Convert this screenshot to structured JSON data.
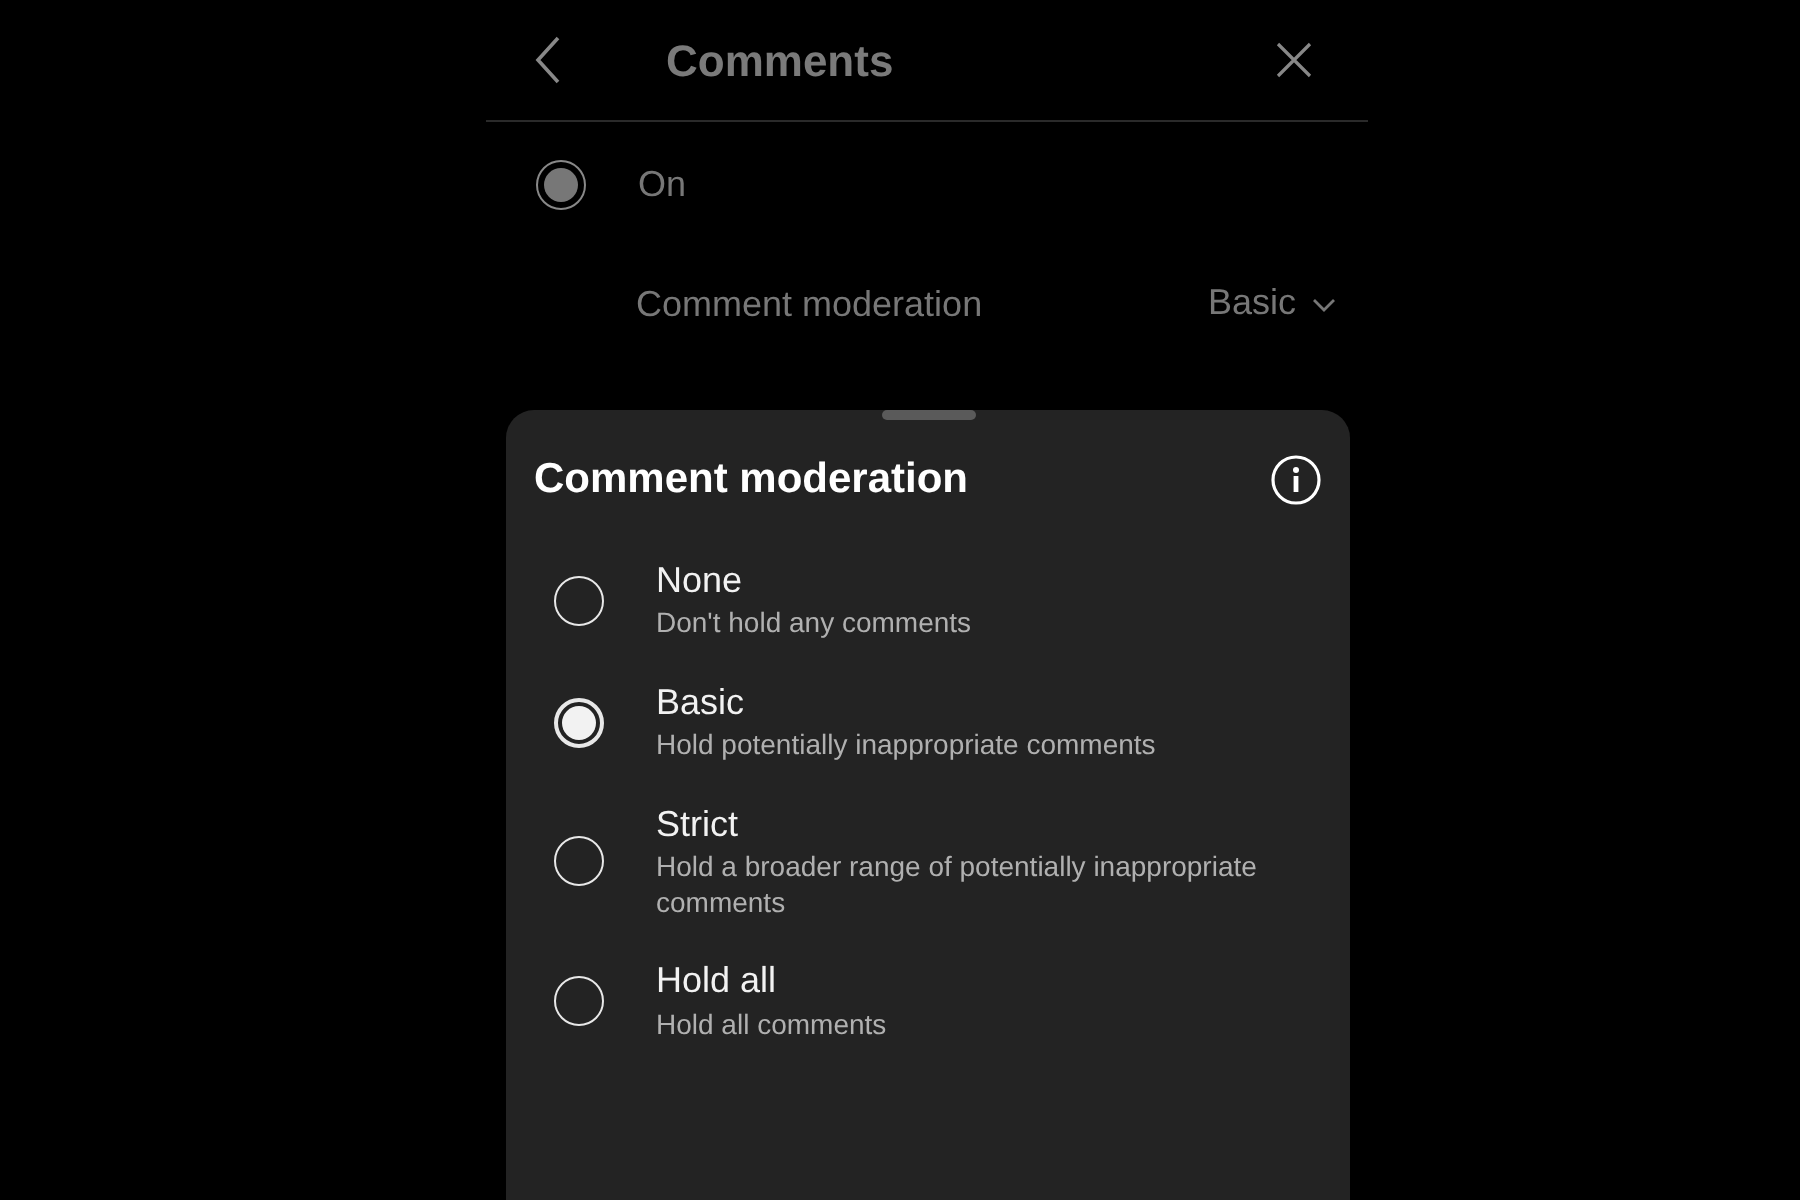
{
  "header": {
    "title": "Comments"
  },
  "comments_toggle": {
    "label": "On",
    "selected": true
  },
  "moderation_row": {
    "label": "Comment moderation",
    "value": "Basic"
  },
  "sheet": {
    "title": "Comment moderation",
    "options": [
      {
        "label": "None",
        "description": "Don't hold any comments",
        "selected": false
      },
      {
        "label": "Basic",
        "description": "Hold potentially inappropriate comments",
        "selected": true
      },
      {
        "label": "Strict",
        "description": "Hold a broader range of potentially inappropriate comments",
        "selected": false
      },
      {
        "label": "Hold all",
        "description": "Hold all comments",
        "selected": false
      }
    ]
  }
}
